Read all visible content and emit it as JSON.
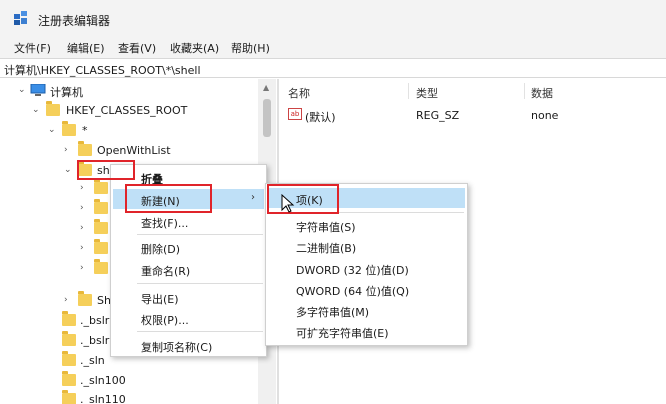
{
  "window": {
    "title": "注册表编辑器",
    "menu": [
      "文件(F)",
      "编辑(E)",
      "查看(V)",
      "收藏夹(A)",
      "帮助(H)"
    ],
    "address": "计算机\\HKEY_CLASSES_ROOT\\*\\shell"
  },
  "tree": {
    "computer": "计算机",
    "hkcr": "HKEY_CLASSES_ROOT",
    "star": "*",
    "openwithlist": "OpenWithList",
    "shell_partial": "sh",
    "sh_partial": "Sh",
    "bslr1": "._bslr",
    "bslr2": "._bslr",
    "sln": "._sln",
    "sln100": "._sln100",
    "sln110": "._sln110"
  },
  "list": {
    "headers": {
      "name": "名称",
      "type": "类型",
      "data": "数据"
    },
    "rows": [
      {
        "name": "(默认)",
        "type": "REG_SZ",
        "data": "none",
        "icon": "string-value-icon"
      }
    ]
  },
  "context_menu": {
    "collapse": "折叠",
    "new": "新建(N)",
    "find": "查找(F)...",
    "delete": "删除(D)",
    "rename": "重命名(R)",
    "export": "导出(E)",
    "permissions": "权限(P)...",
    "copy_key_name": "复制项名称(C)"
  },
  "submenu": {
    "key": "项(K)",
    "string": "字符串值(S)",
    "binary": "二进制值(B)",
    "dword": "DWORD (32 位)值(D)",
    "qword": "QWORD (64 位)值(Q)",
    "multi_string": "多字符串值(M)",
    "expandable_string": "可扩充字符串值(E)"
  },
  "colors": {
    "highlight": "#bfe0f7",
    "annotation_red": "#e0242a",
    "folder": "#f5cf5a"
  }
}
